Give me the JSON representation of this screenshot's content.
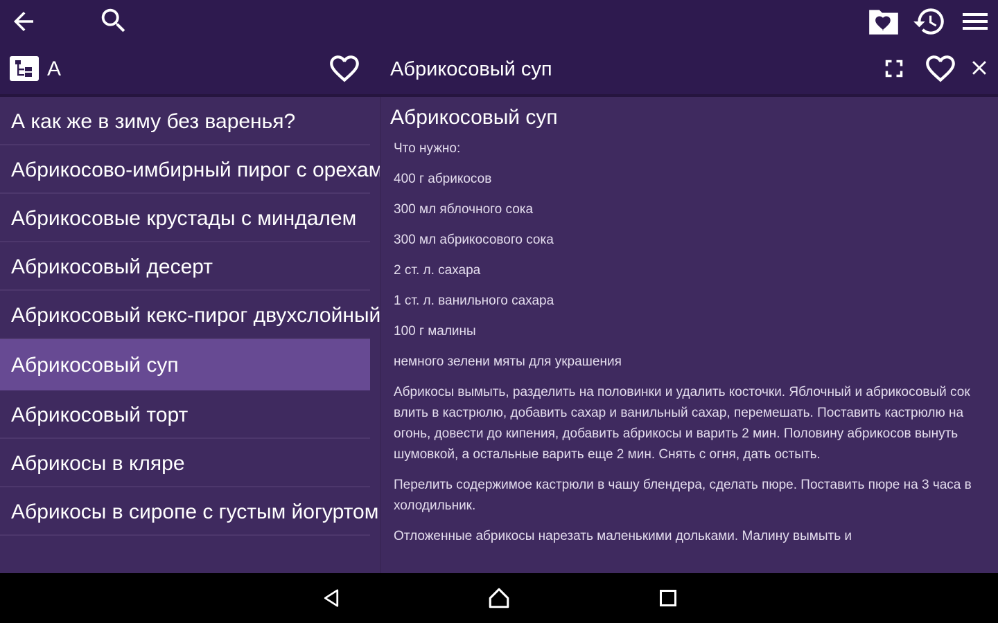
{
  "toolbar": {
    "back_icon": "arrow-left-icon",
    "search_icon": "search-icon",
    "folder_heart_icon": "folder-heart-icon",
    "history_icon": "history-icon",
    "menu_icon": "hamburger-menu-icon"
  },
  "subheader": {
    "category_icon": "category-tree-icon",
    "category_letter": "А",
    "favorite_icon": "heart-outline-icon",
    "detail_title": "Абрикосовый суп",
    "fullscreen_icon": "fullscreen-icon",
    "detail_favorite_icon": "heart-outline-icon",
    "close_icon": "close-icon"
  },
  "list": {
    "items": [
      {
        "label": "А как же в зиму без варенья?",
        "selected": false
      },
      {
        "label": "Абрикосово-имбирный пирог с орехами",
        "selected": false
      },
      {
        "label": "Абрикосовые крустады с миндалем",
        "selected": false
      },
      {
        "label": "Абрикосовый десерт",
        "selected": false
      },
      {
        "label": "Абрикосовый кекс-пирог двухслойный",
        "selected": false
      },
      {
        "label": "Абрикосовый суп",
        "selected": true
      },
      {
        "label": "Абрикосовый торт",
        "selected": false
      },
      {
        "label": "Абрикосы в кляре",
        "selected": false
      },
      {
        "label": "Абрикосы в сиропе с густым йогуртом",
        "selected": false
      }
    ]
  },
  "content": {
    "title": "Абрикосовый суп",
    "lines": [
      "Что нужно:",
      "400 г абрикосов",
      "300 мл яблочного сока",
      "300 мл абрикосового сока",
      "2 ст. л. сахара",
      "1 ст. л. ванильного сахара",
      "100 г малины",
      "немного зелени мяты для украшения"
    ],
    "paragraphs": [
      "Абрикосы вымыть, разделить на половинки и удалить косточки. Яблочный и абрикосовый сок влить в кастрюлю, добавить сахар и ванильный сахар, перемешать. Поставить кастрюлю на огонь, довести до кипения, добавить абрикосы и варить 2 мин. Половину абрикосов вынуть шумовкой, а остальные варить еще 2 мин. Снять с огня, дать остыть.",
      "Перелить содержимое кастрюли в чашу блендера, сделать пюре. Поставить пюре на 3 часа в холодильник.",
      "Отложенные абрикосы нарезать маленькими дольками. Малину вымыть и"
    ]
  },
  "navbar": {
    "back_icon": "nav-back-triangle-icon",
    "home_icon": "nav-home-icon",
    "recents_icon": "nav-recents-square-icon"
  },
  "colors": {
    "toolbar_bg": "#2e1a4f",
    "background": "#3f2a5f",
    "selected_item": "#674a93",
    "navbar_bg": "#000000"
  }
}
